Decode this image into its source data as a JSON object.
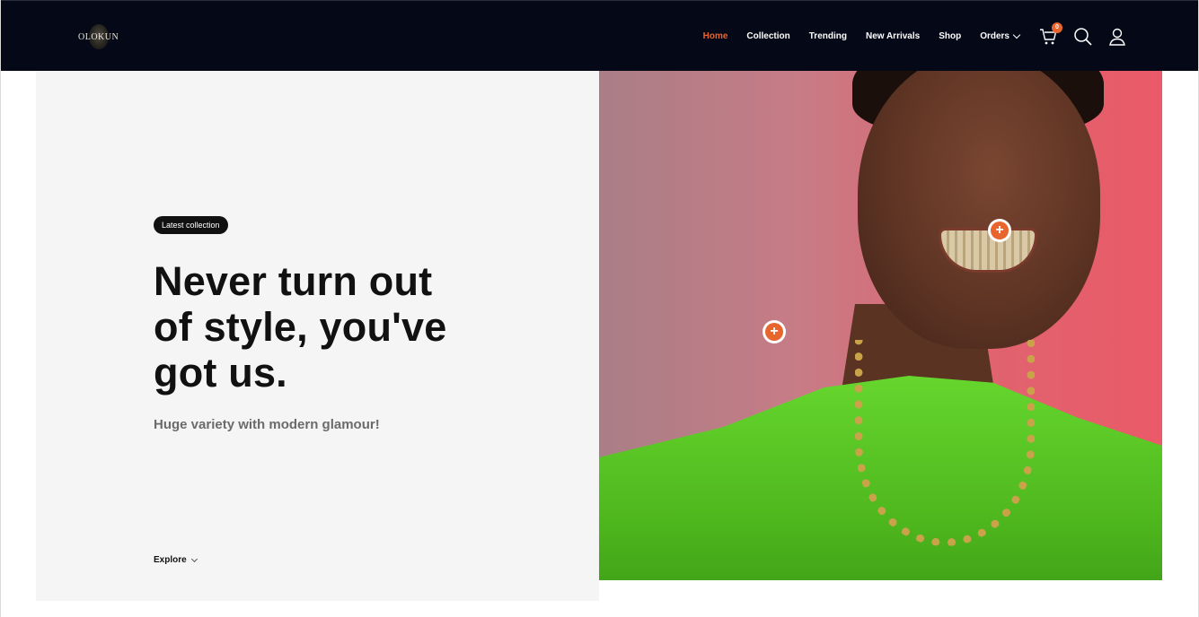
{
  "header": {
    "logo_text": "OLOKUN",
    "nav": [
      {
        "label": "Home"
      },
      {
        "label": "Collection"
      },
      {
        "label": "Trending"
      },
      {
        "label": "New Arrivals"
      },
      {
        "label": "Shop"
      },
      {
        "label": "Orders"
      }
    ],
    "cart_count": "0",
    "icons": [
      "cart-icon",
      "search-icon",
      "user-icon"
    ]
  },
  "hero": {
    "badge": "Latest collection",
    "headline": "Never turn out of style, you've got us.",
    "subtitle": "Huge variety with modern glamour!",
    "explore_label": "Explore"
  },
  "colors": {
    "header_bg": "#050817",
    "accent": "#e8652d",
    "hero_bg": "#f5f5f5",
    "text_dark": "#111111"
  }
}
